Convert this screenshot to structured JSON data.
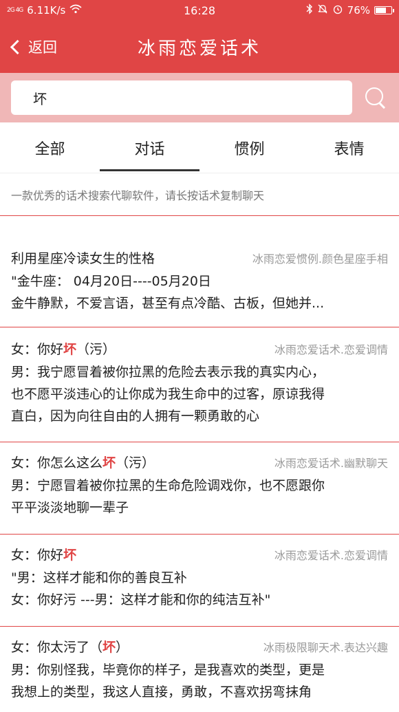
{
  "status_bar": {
    "signal": "2G 4G",
    "speed": "6.11K/s",
    "time": "16:28",
    "battery": "76%",
    "battery_level": 0.76,
    "icons": [
      "wifi-icon",
      "bluetooth-icon",
      "mute-icon",
      "alarm-icon",
      "battery-icon"
    ]
  },
  "nav": {
    "back_label": "返回",
    "title": "冰雨恋爱话术"
  },
  "search": {
    "value": "坏"
  },
  "tabs": [
    {
      "label": "全部",
      "active": false
    },
    {
      "label": "对话",
      "active": true
    },
    {
      "label": "惯例",
      "active": false
    },
    {
      "label": "表情",
      "active": false
    }
  ],
  "hint": "一款优秀的话术搜索代聊软件，请长按话术复制聊天",
  "items": [
    {
      "title": "利用星座冷读女生的性格",
      "source": "冰雨恋爱惯例.颜色星座手相",
      "line2": "\"金牛座： 04月20日----05月20日",
      "line3": "金牛静默，不爱言语，甚至有点冷酷、古板，但她并..."
    },
    {
      "head_pre": "女：你好",
      "head_hl": "坏",
      "head_post": "（污）",
      "source": "冰雨恋爱话术.恋爱调情",
      "line2": "男：我宁愿冒着被你拉黑的危险去表示我的真实内心，",
      "line3": "也不愿平淡违心的让你成为我生命中的过客，原谅我得",
      "line4": "直白，因为向往自由的人拥有一颗勇敢的心"
    },
    {
      "head_pre": "女：你怎么这么",
      "head_hl": "坏",
      "head_post": "（污）",
      "source": "冰雨恋爱话术.幽默聊天",
      "line2": "男：宁愿冒着被你拉黑的生命危险调戏你，也不愿跟你",
      "line3": "平平淡淡地聊一辈子"
    },
    {
      "head_pre": "女：你好",
      "head_hl": "坏",
      "head_post": "",
      "source": "冰雨恋爱话术.恋爱调情",
      "line2": "\"男：这样才能和你的善良互补",
      "line3": "女：你好污 ---男：这样才能和你的纯洁互补\""
    },
    {
      "head_pre": "女：你太污了（",
      "head_hl": "坏",
      "head_post": "）",
      "source": "冰雨极限聊天术.表达兴趣",
      "line2": "男：你别怪我，毕竟你的样子，是我喜欢的类型，更是",
      "line3": "我想上的类型，我这人直接，勇敢，不喜欢拐弯抹角"
    }
  ],
  "colors": {
    "brand": "#e04545",
    "search_bg": "#f0b7b7",
    "highlight": "#e04545"
  }
}
